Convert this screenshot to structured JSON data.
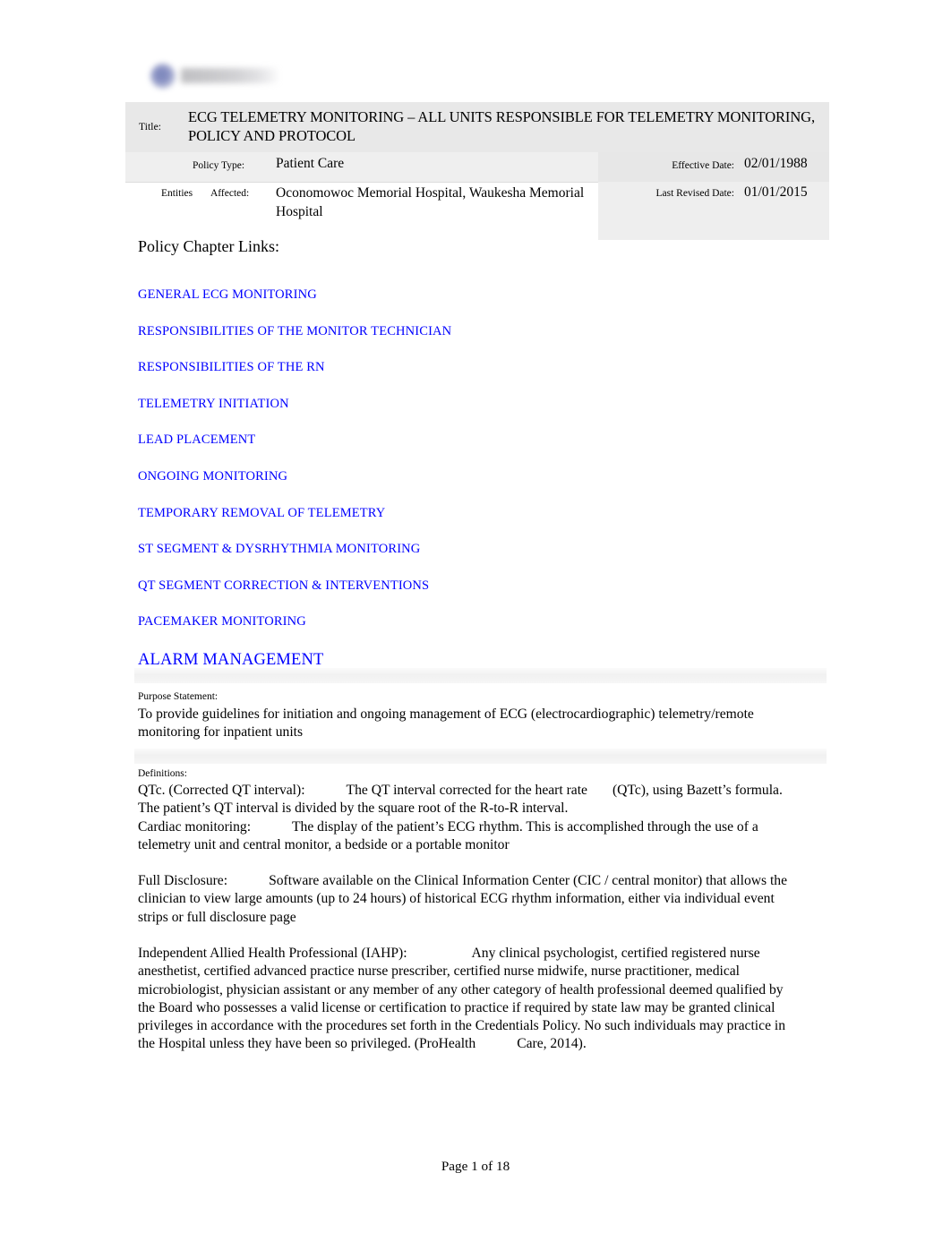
{
  "logo": {
    "alt": "organization-logo-redacted"
  },
  "header": {
    "title_label": "Title:",
    "title_value": "ECG TELEMETRY MONITORING – ALL UNITS RESPONSIBLE FOR TELEMETRY MONITORING, POLICY AND PROTOCOL",
    "policy_type_label": "Policy Type:",
    "policy_type_value": "Patient Care",
    "entities_label": "Entities",
    "affected_label": "Affected:",
    "entities_value": "Oconomowoc Memorial Hospital, Waukesha Memorial Hospital",
    "effective_date_label": "Effective Date:",
    "effective_date_value": "02/01/1988",
    "last_revised_label": "Last Revised Date:",
    "last_revised_value": "01/01/2015"
  },
  "chapter_links": {
    "heading": "Policy Chapter Links:",
    "items": [
      {
        "label": "GENERAL ECG MONITORING",
        "emphasis": false
      },
      {
        "label": "RESPONSIBILITIES OF THE MONITOR TECHNICIAN",
        "emphasis": false
      },
      {
        "label": "RESPONSIBILITIES OF THE RN",
        "emphasis": false
      },
      {
        "label": "TELEMETRY INITIATION",
        "emphasis": false
      },
      {
        "label": "LEAD PLACEMENT",
        "emphasis": false
      },
      {
        "label": "ONGOING MONITORING",
        "emphasis": false
      },
      {
        "label": "TEMPORARY REMOVAL OF TELEMETRY",
        "emphasis": false
      },
      {
        "label": "ST SEGMENT & DYSRHYTHMIA MONITORING",
        "emphasis": false
      },
      {
        "label": "QT SEGMENT CORRECTION & INTERVENTIONS",
        "emphasis": false
      },
      {
        "label": "PACEMAKER MONITORING",
        "emphasis": false
      },
      {
        "label": "ALARM MANAGEMENT",
        "emphasis": true
      }
    ],
    "link_color": "#0000ff"
  },
  "purpose": {
    "label": "Purpose Statement:",
    "text": "To provide guidelines for initiation and ongoing management of ECG (electrocardiographic) telemetry/remote monitoring for inpatient units"
  },
  "definitions": {
    "label": "Definitions:",
    "qtc_term": "QTc. (Corrected QT interval):",
    "qtc_text_a": "The QT interval corrected for the heart rate",
    "qtc_text_b": "(QTc), using Bazett’s formula. The patient’s QT interval is divided by the square root of the R-to-R interval.",
    "cardiac_term": "Cardiac monitoring:",
    "cardiac_text": "The display of the patient’s ECG rhythm. This is accomplished through the use of a telemetry unit and central monitor, a bedside or a portable monitor",
    "full_disclosure_term": "Full Disclosure:",
    "full_disclosure_text": "Software available on the Clinical Information Center (CIC / central monitor) that allows the clinician to view large amounts (up to 24 hours) of historical ECG rhythm information, either via individual event strips or full disclosure page",
    "iahp_term": "Independent Allied Health Professional (IAHP):",
    "iahp_text_a": "Any clinical psychologist, certified registered nurse anesthetist, certified advanced practice nurse prescriber, certified nurse midwife, nurse practitioner, medical microbiologist, physician assistant or any member of any other category of health professional deemed qualified by the Board who possesses a valid license or certification to practice if required by state law may be granted clinical privileges in accordance with the procedures set forth in the Credentials Policy. No such individuals may practice in the Hospital unless they have been so privileged. (ProHealth",
    "iahp_text_b": "Care, 2014)."
  },
  "footer": {
    "page_number": "Page 1 of 18"
  }
}
